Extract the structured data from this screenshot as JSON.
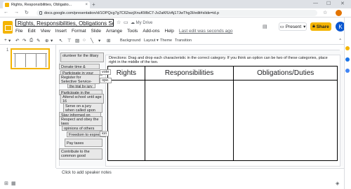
{
  "browser": {
    "tab_title": "Rights, Responsibilities, Obligatio...",
    "tab_close": "×",
    "new_tab": "+",
    "url": "docs.google.com/presentation/d/1OPQcg7g7C62wzjXnuKMbC7-Jv2aKfUrAj17JwThg3I/edit#slide=id.p",
    "back": "←",
    "forward": "→",
    "reload": "↻",
    "minimize": "—",
    "maximize": "☐",
    "close": "✕"
  },
  "app": {
    "title": "Rights, Responsibilities, Obligations Sort",
    "star": "☆",
    "drive_label": "My Drive",
    "menu": [
      "File",
      "Edit",
      "View",
      "Insert",
      "Format",
      "Slide",
      "Arrange",
      "Tools",
      "Add-ons",
      "Help"
    ],
    "last_edit": "Last edit was seconds ago",
    "present_label": "Present",
    "share_label": "Share",
    "avatar_letter": "K",
    "brand_color": "#f4b400"
  },
  "toolbar": {
    "background": "Background",
    "layout": "Layout ▾",
    "theme": "Theme",
    "transition": "Transition"
  },
  "filmstrip": {
    "slide_number": "1"
  },
  "slide": {
    "directions": "Directions: Drag and drop each characteristic in the correct category. If you think an option can be two of these categories, place right in the middle of the two.",
    "table_headers": [
      "Rights",
      "Responsibilities",
      "Obligations/Duties"
    ]
  },
  "cards": [
    "olunteer for the ilitary",
    "Donate time & money",
    "Participate in your local",
    "Register for Selective Service- males 18-24",
    "the trial by jury",
    "Participate in the",
    "Attend school until age 16",
    "Serve on a jury when called upon",
    "Stay informed on",
    "Respect and obey the laws",
    "opinions of others",
    "Freedom to express",
    "Pay taxes",
    "Contribute to the common good"
  ],
  "mini_labels": [
    "vote",
    "ope.",
    "ion"
  ],
  "notes": {
    "placeholder": "Click to add speaker notes"
  }
}
